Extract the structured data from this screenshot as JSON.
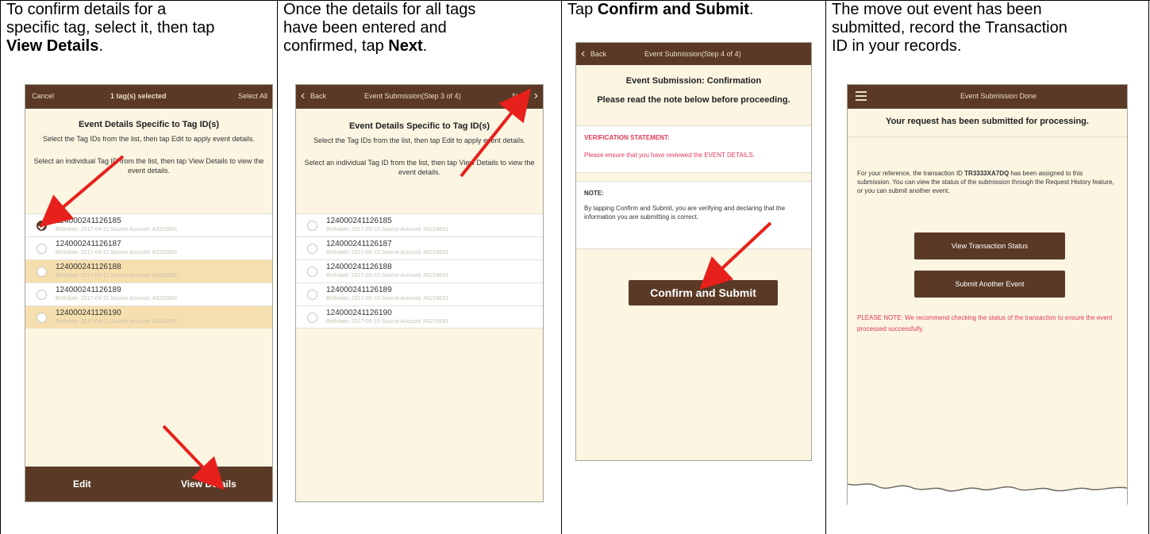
{
  "columns": [
    {
      "instruction": {
        "line1": "To confirm details for a",
        "line2": "specific tag, select it, then tap",
        "bold": "View Details",
        "tail": "."
      },
      "screen": {
        "nav": {
          "left": "Cancel",
          "title": "1 tag(s) selected",
          "right": "Select All"
        },
        "heading": "Event Details Specific to Tag ID(s)",
        "para1": "Select the Tag IDs from the list, then tap Edit to apply event details.",
        "para2": "Select an individual Tag ID from the list, then tap View Details to view the event details.",
        "rows": [
          {
            "tag": "124000241126185",
            "sub": "Birthdate: 2017-04-11 Source Account: A5216691",
            "checked": true,
            "highlight": false
          },
          {
            "tag": "124000241126187",
            "sub": "Birthdate: 2017-04-11 Source Account: A5216691",
            "checked": false,
            "highlight": false
          },
          {
            "tag": "124000241126188",
            "sub": "Birthdate: 2017-04-11 Source Account: A5216691",
            "checked": false,
            "highlight": true
          },
          {
            "tag": "124000241126189",
            "sub": "Birthdate: 2017-04-11 Source Account: A5216691",
            "checked": false,
            "highlight": false
          },
          {
            "tag": "124000241126190",
            "sub": "Birthdate: 2017-04-11 Source Account: A5216691",
            "checked": false,
            "highlight": true
          }
        ],
        "edit": "Edit",
        "view_details": "View Details"
      }
    },
    {
      "instruction": {
        "line1": "Once the details for all tags",
        "line2": "have been entered and",
        "line3_pre": "confirmed, tap ",
        "bold": "Next",
        "tail": "."
      },
      "screen": {
        "nav": {
          "left": "Back",
          "title": "Event Submission(Step 3 of 4)",
          "right": "Next"
        },
        "heading": "Event Details Specific to Tag ID(s)",
        "para1": "Select the Tag IDs from the list, then tap Edit to apply event details.",
        "para2": "Select an individual Tag ID from the list, then tap View Details to view the event details.",
        "rows": [
          {
            "tag": "124000241126185",
            "sub": "Birthdate: 2017-05-10 Source Account: A5216691"
          },
          {
            "tag": "124000241126187",
            "sub": "Birthdate: 2017-05-10 Source Account: A5216691"
          },
          {
            "tag": "124000241126188",
            "sub": "Birthdate: 2017-05-10 Source Account: A5216691"
          },
          {
            "tag": "124000241126189",
            "sub": "Birthdate: 2017-05-10 Source Account: A5216691"
          },
          {
            "tag": "124000241126190",
            "sub": "Birthdate: 2017-05-10 Source Account: A5216691"
          }
        ]
      }
    },
    {
      "instruction": {
        "pre": "Tap ",
        "bold": "Confirm and Submit",
        "tail": "."
      },
      "screen": {
        "nav": {
          "left": "Back",
          "title": "Event Submission(Step 4 of 4)"
        },
        "heading": "Event Submission: Confirmation",
        "subheading": "Please read the note below before proceeding.",
        "verification_label": "VERIFICATION STATEMENT:",
        "verification_text": "Please ensure that you have reviewed the EVENT DETAILS.",
        "note_label": "NOTE:",
        "note_text": "By tapping Confirm and Submit, you are verifying and declaring that the information you are submitting is correct.",
        "button": "Confirm and Submit"
      }
    },
    {
      "instruction": {
        "line1": "The move out event has been",
        "line2": "submitted, record the Transaction",
        "line3": "ID in your records."
      },
      "screen": {
        "nav": {
          "title": "Event Submission Done"
        },
        "heading": "Your request has been submitted for processing.",
        "ref_pre": "For your reference, the transaction ID ",
        "ref_id": "TR3333XA7DQ",
        "ref_post": " has been assigned to this submission. You can view the status of the submission through the Request History feature, or you can submit another event.",
        "btn_status": "View Transaction Status",
        "btn_another": "Submit Another Event",
        "please_note": "PLEASE NOTE: We recommend checking the status of the transaction to ensure the event processed successfully."
      }
    }
  ],
  "colors": {
    "brand_brown": "#5a3a26",
    "screen_bg": "#fbf5e2",
    "highlight_row": "#f6dfae",
    "alert_red": "#e03a5b",
    "arrow_red": "#e8201c"
  }
}
